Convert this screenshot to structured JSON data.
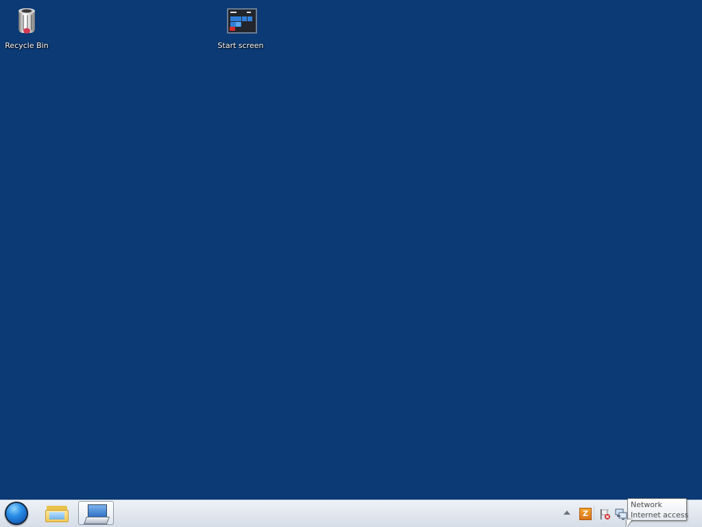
{
  "desktop": {
    "background": "#0b3a75",
    "icons": [
      {
        "label": "Recycle Bin",
        "icon": "recycle-bin-icon"
      },
      {
        "label": "Start screen",
        "icon": "start-screen-icon"
      }
    ]
  },
  "taskbar": {
    "start_button_icon": "start-orb-icon",
    "pinned": [
      {
        "icon": "file-explorer-icon"
      },
      {
        "icon": "on-screen-keyboard-icon",
        "active": true
      }
    ],
    "tray": {
      "overflow_icon": "chevron-up-icon",
      "items": [
        "app-tray-icon",
        "action-center-flag-icon",
        "network-icon"
      ],
      "app_glyph": "Z"
    }
  },
  "tooltip": {
    "title": "Network",
    "status": "Internet access"
  },
  "colors": {
    "desktop": "#0b3a75",
    "taskbar": "#e3e8ef",
    "orb_accent": "#2a8ee6"
  }
}
